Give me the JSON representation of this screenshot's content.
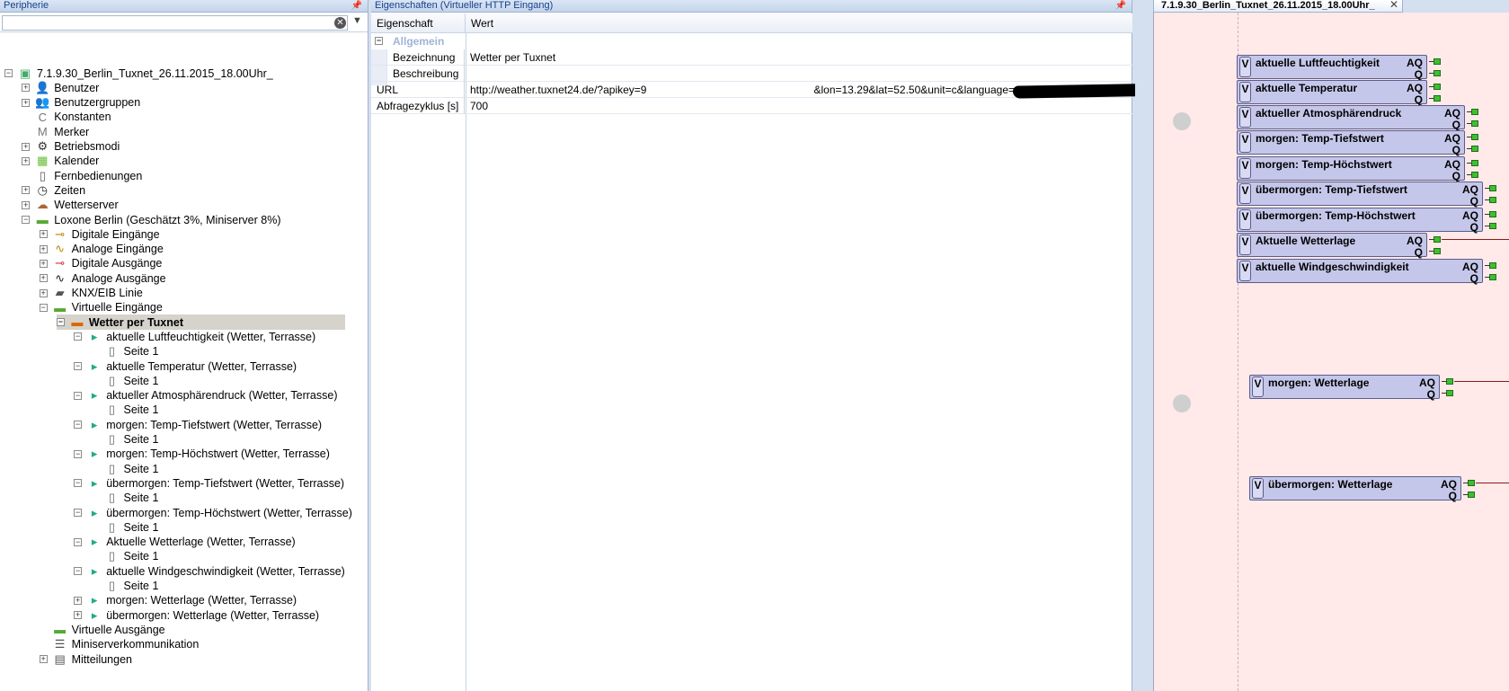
{
  "left_panel": {
    "title": "Peripherie",
    "search": {
      "value": "",
      "placeholder": ""
    },
    "tree": [
      {
        "label": "7.1.9.30_Berlin_Tuxnet_26.11.2015_18.00Uhr_",
        "level": 0,
        "exp": "-",
        "icon": "project-icon"
      },
      {
        "label": "Benutzer",
        "level": 1,
        "exp": "+",
        "icon": "user-icon"
      },
      {
        "label": "Benutzergruppen",
        "level": 1,
        "exp": "+",
        "icon": "user-group-icon"
      },
      {
        "label": "Konstanten",
        "level": 1,
        "exp": "",
        "icon": "constant-icon"
      },
      {
        "label": "Merker",
        "level": 1,
        "exp": "",
        "icon": "marker-icon"
      },
      {
        "label": "Betriebsmodi",
        "level": 1,
        "exp": "+",
        "icon": "gear-icon"
      },
      {
        "label": "Kalender",
        "level": 1,
        "exp": "+",
        "icon": "calendar-icon"
      },
      {
        "label": "Fernbedienungen",
        "level": 1,
        "exp": "",
        "icon": "remote-icon"
      },
      {
        "label": "Zeiten",
        "level": 1,
        "exp": "+",
        "icon": "clock-icon"
      },
      {
        "label": "Wetterserver",
        "level": 1,
        "exp": "+",
        "icon": "weather-icon"
      },
      {
        "label": "Loxone Berlin (Geschätzt 3%, Miniserver 8%)",
        "level": 1,
        "exp": "-",
        "icon": "miniserver-icon"
      },
      {
        "label": "Digitale Eingänge",
        "level": 2,
        "exp": "+",
        "icon": "digital-input-icon"
      },
      {
        "label": "Analoge Eingänge",
        "level": 2,
        "exp": "+",
        "icon": "analog-input-icon"
      },
      {
        "label": "Digitale Ausgänge",
        "level": 2,
        "exp": "+",
        "icon": "digital-output-icon"
      },
      {
        "label": "Analoge Ausgänge",
        "level": 2,
        "exp": "+",
        "icon": "analog-output-icon"
      },
      {
        "label": "KNX/EIB Linie",
        "level": 2,
        "exp": "+",
        "icon": "knx-icon"
      },
      {
        "label": "Virtuelle Eingänge",
        "level": 2,
        "exp": "-",
        "icon": "virtual-input-icon"
      },
      {
        "label": "Wetter per Tuxnet",
        "level": 3,
        "exp": "-",
        "icon": "http-input-icon",
        "selected": true
      },
      {
        "label": "aktuelle Luftfeuchtigkeit (Wetter, Terrasse)",
        "level": 4,
        "exp": "-",
        "icon": "command-icon"
      },
      {
        "label": "Seite 1",
        "level": 5,
        "exp": "",
        "icon": "page-icon"
      },
      {
        "label": "aktuelle Temperatur (Wetter, Terrasse)",
        "level": 4,
        "exp": "-",
        "icon": "command-icon"
      },
      {
        "label": "Seite 1",
        "level": 5,
        "exp": "",
        "icon": "page-icon"
      },
      {
        "label": "aktueller Atmosphärendruck (Wetter, Terrasse)",
        "level": 4,
        "exp": "-",
        "icon": "command-icon"
      },
      {
        "label": "Seite 1",
        "level": 5,
        "exp": "",
        "icon": "page-icon"
      },
      {
        "label": "morgen: Temp-Tiefstwert (Wetter, Terrasse)",
        "level": 4,
        "exp": "-",
        "icon": "command-icon"
      },
      {
        "label": "Seite 1",
        "level": 5,
        "exp": "",
        "icon": "page-icon"
      },
      {
        "label": "morgen: Temp-Höchstwert (Wetter, Terrasse)",
        "level": 4,
        "exp": "-",
        "icon": "command-icon"
      },
      {
        "label": "Seite 1",
        "level": 5,
        "exp": "",
        "icon": "page-icon"
      },
      {
        "label": "übermorgen: Temp-Tiefstwert (Wetter, Terrasse)",
        "level": 4,
        "exp": "-",
        "icon": "command-icon"
      },
      {
        "label": "Seite 1",
        "level": 5,
        "exp": "",
        "icon": "page-icon"
      },
      {
        "label": "übermorgen: Temp-Höchstwert (Wetter, Terrasse)",
        "level": 4,
        "exp": "-",
        "icon": "command-icon"
      },
      {
        "label": "Seite 1",
        "level": 5,
        "exp": "",
        "icon": "page-icon"
      },
      {
        "label": "Aktuelle Wetterlage (Wetter, Terrasse)",
        "level": 4,
        "exp": "-",
        "icon": "command-icon"
      },
      {
        "label": "Seite 1",
        "level": 5,
        "exp": "",
        "icon": "page-icon"
      },
      {
        "label": "aktuelle Windgeschwindigkeit (Wetter, Terrasse)",
        "level": 4,
        "exp": "-",
        "icon": "command-icon"
      },
      {
        "label": "Seite 1",
        "level": 5,
        "exp": "",
        "icon": "page-icon"
      },
      {
        "label": "morgen: Wetterlage (Wetter, Terrasse)",
        "level": 4,
        "exp": "+",
        "icon": "command-icon"
      },
      {
        "label": "übermorgen: Wetterlage (Wetter, Terrasse)",
        "level": 4,
        "exp": "+",
        "icon": "command-icon"
      },
      {
        "label": "Virtuelle Ausgänge",
        "level": 2,
        "exp": "",
        "icon": "virtual-output-icon"
      },
      {
        "label": "Miniserverkommunikation",
        "level": 2,
        "exp": "",
        "icon": "network-icon"
      },
      {
        "label": "Mitteilungen",
        "level": 2,
        "exp": "+",
        "icon": "message-icon"
      }
    ]
  },
  "properties": {
    "title": "Eigenschaften (Virtueller HTTP Eingang)",
    "col_name": "Eigenschaft",
    "col_value": "Wert",
    "category": "Allgemein",
    "rows": [
      {
        "name": "Bezeichnung",
        "value": "Wetter per Tuxnet",
        "indent": true
      },
      {
        "name": "Beschreibung",
        "value": "",
        "indent": true
      },
      {
        "name": "URL",
        "value": "http://weather.tuxnet24.de/?apikey=9",
        "value2": "&lon=13.29&lat=52.50&unit=c&language=de&mode=xml",
        "indent": false
      },
      {
        "name": "Abfragezyklus [s]",
        "value": "700",
        "indent": false
      }
    ]
  },
  "canvas": {
    "tab_label": "7.1.9.30_Berlin_Tuxnet_26.11.2015_18.00Uhr_",
    "blocks": [
      {
        "v": "V",
        "label": "aktuelle Luftfeuchtigkeit",
        "aq": "AQ",
        "q": "Q"
      },
      {
        "v": "V",
        "label": "aktuelle Temperatur",
        "aq": "AQ",
        "q": "Q"
      },
      {
        "v": "V",
        "label": "aktueller Atmosphärendruck",
        "aq": "AQ",
        "q": "Q"
      },
      {
        "v": "V",
        "label": "morgen: Temp-Tiefstwert",
        "aq": "AQ",
        "q": "Q"
      },
      {
        "v": "V",
        "label": "morgen: Temp-Höchstwert",
        "aq": "AQ",
        "q": "Q"
      },
      {
        "v": "V",
        "label": "übermorgen: Temp-Tiefstwert",
        "aq": "AQ",
        "q": "Q"
      },
      {
        "v": "V",
        "label": "übermorgen: Temp-Höchstwert",
        "aq": "AQ",
        "q": "Q"
      },
      {
        "v": "V",
        "label": "Aktuelle Wetterlage",
        "aq": "AQ",
        "q": "Q"
      },
      {
        "v": "V",
        "label": "aktuelle Windgeschwindigkeit",
        "aq": "AQ",
        "q": "Q"
      },
      {
        "v": "V",
        "label": "morgen: Wetterlage",
        "aq": "AQ",
        "q": "Q"
      },
      {
        "v": "V",
        "label": "übermorgen: Wetterlage",
        "aq": "AQ",
        "q": "Q"
      }
    ]
  },
  "colors": {
    "canvas_bg": "#ffe9e9",
    "block_bg": "#c5c7ea",
    "pin_green": "#3fbf2f",
    "selection": "#d6d3cc",
    "header_text": "#15428b"
  }
}
